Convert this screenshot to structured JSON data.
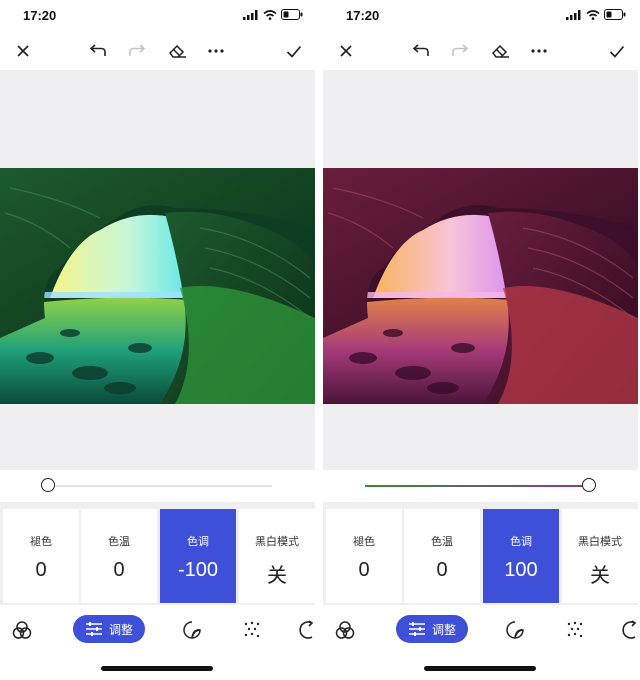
{
  "status": {
    "time": "17:20"
  },
  "screens": [
    {
      "slider": {
        "value": -100,
        "min": -100,
        "max": 100
      },
      "tools": [
        {
          "label": "褪色",
          "value": "0",
          "active": false
        },
        {
          "label": "色温",
          "value": "0",
          "active": false
        },
        {
          "label": "色调",
          "value": "-100",
          "active": true
        },
        {
          "label": "黑白模式",
          "value": "关",
          "active": false
        }
      ],
      "nav_active_label": "调整",
      "photo_tint": "green"
    },
    {
      "slider": {
        "value": 100,
        "min": -100,
        "max": 100
      },
      "tools": [
        {
          "label": "褪色",
          "value": "0",
          "active": false
        },
        {
          "label": "色温",
          "value": "0",
          "active": false
        },
        {
          "label": "色调",
          "value": "100",
          "active": true
        },
        {
          "label": "黑白模式",
          "value": "关",
          "active": false
        }
      ],
      "nav_active_label": "调整",
      "photo_tint": "magenta"
    }
  ],
  "toolbar_icons": [
    "close-icon",
    "undo-icon",
    "redo-icon",
    "eraser-icon",
    "more-icon",
    "check-icon"
  ],
  "nav_icons": [
    "filters-icon",
    "adjust-icon",
    "sticker-icon",
    "effects-icon",
    "crop-icon"
  ],
  "colors": {
    "accent": "#3e4fd8",
    "track_green": "#3a8a3a",
    "track_purple": "#8a3a8a",
    "background": "#efeff2"
  }
}
